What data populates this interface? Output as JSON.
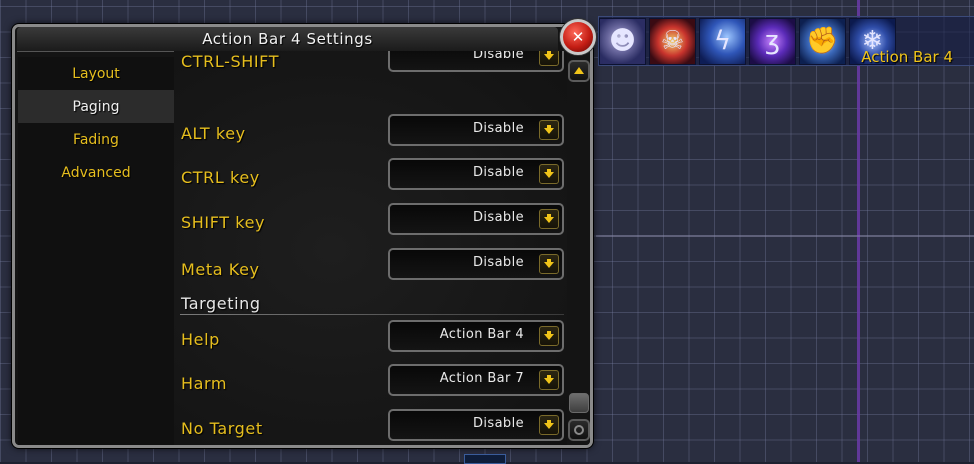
{
  "window": {
    "title": "Action Bar 4 Settings"
  },
  "sidebar": {
    "items": [
      {
        "label": "Layout",
        "active": false
      },
      {
        "label": "Paging",
        "active": true
      },
      {
        "label": "Fading",
        "active": false
      },
      {
        "label": "Advanced",
        "active": false
      }
    ]
  },
  "modifiers": {
    "rows": [
      {
        "label": "CTRL-SHIFT",
        "value": "Disable"
      },
      {
        "label": "ALT key",
        "value": "Disable"
      },
      {
        "label": "CTRL key",
        "value": "Disable"
      },
      {
        "label": "SHIFT key",
        "value": "Disable"
      },
      {
        "label": "Meta Key",
        "value": "Disable"
      }
    ]
  },
  "targeting": {
    "header": "Targeting",
    "rows": [
      {
        "label": "Help",
        "value": "Action Bar 4"
      },
      {
        "label": "Harm",
        "value": "Action Bar 7"
      },
      {
        "label": "No Target",
        "value": "Disable"
      }
    ]
  },
  "action_bar_preview": {
    "label": "Action Bar 4",
    "icons": [
      "portrait-icon",
      "skull-emblem-icon",
      "lightning-hand-icon",
      "arcane-swirl-icon",
      "fist-icon",
      "frost-icon"
    ]
  },
  "colors": {
    "gold_text": "#e6be1e",
    "window_bg": "#141414",
    "grid_line": "#787da0",
    "divider_purple": "#6a3aa8"
  }
}
